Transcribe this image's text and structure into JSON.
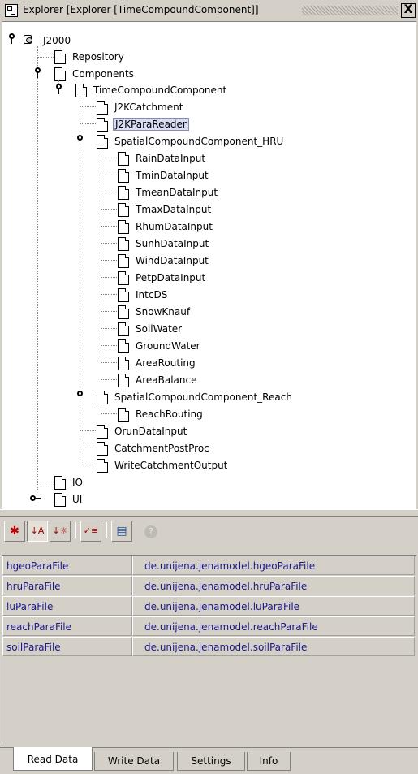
{
  "window": {
    "title": "Explorer [Explorer [TimeCompoundComponent]]",
    "close_glyph": "X"
  },
  "tree": {
    "root": "J2000",
    "items": [
      "Repository",
      "Components",
      "TimeCompoundComponent",
      "J2KCatchment",
      "J2KParaReader",
      "SpatialCompoundComponent_HRU",
      "RainDataInput",
      "TminDataInput",
      "TmeanDataInput",
      "TmaxDataInput",
      "RhumDataInput",
      "SunhDataInput",
      "WindDataInput",
      "PetpDataInput",
      "IntcDS",
      "SnowKnauf",
      "SoilWater",
      "GroundWater",
      "AreaRouting",
      "AreaBalance",
      "SpatialCompoundComponent_Reach",
      "ReachRouting",
      "OrunDataInput",
      "CatchmentPostProc",
      "WriteCatchmentOutput",
      "IO",
      "UI"
    ],
    "selected": "J2KParaReader"
  },
  "toolbar": {
    "icons": [
      "asterisk-icon",
      "sort-alpha-icon",
      "sort-category-icon",
      "checklist-icon",
      "grid-icon",
      "help-icon"
    ],
    "glyphs": [
      "✱",
      "↓A",
      "↓☼",
      "✓≡",
      "▤",
      "?"
    ]
  },
  "properties": {
    "rows": [
      {
        "name": "hgeoParaFile",
        "value": "de.unijena.jenamodel.hgeoParaFile"
      },
      {
        "name": "hruParaFile",
        "value": "de.unijena.jenamodel.hruParaFile"
      },
      {
        "name": "luParaFile",
        "value": "de.unijena.jenamodel.luParaFile"
      },
      {
        "name": "reachParaFile",
        "value": "de.unijena.jenamodel.reachParaFile"
      },
      {
        "name": "soilParaFile",
        "value": "de.unijena.jenamodel.soilParaFile"
      }
    ]
  },
  "tabs": [
    "Read Data",
    "Write Data",
    "Settings",
    "Info"
  ],
  "active_tab": "Read Data",
  "colors": {
    "selection": "#d8dcf4",
    "property_text": "#1a1a8a",
    "chrome": "#d4d0c8"
  }
}
